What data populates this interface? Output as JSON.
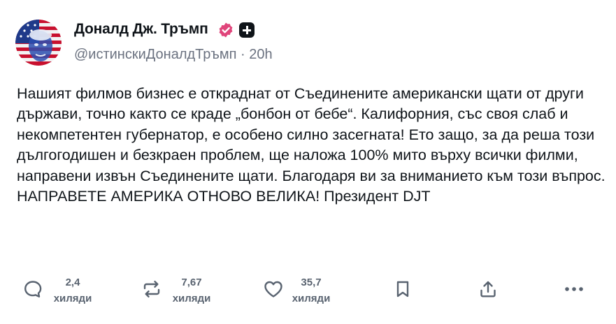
{
  "author": {
    "name": "Доналд Дж. Тръмп",
    "handle": "@истинскиДоналдТръмп",
    "separator": "·",
    "time": "20h",
    "verified_color": "#e0457b"
  },
  "post": {
    "text": "Нашият филмов бизнес е откраднат от Съединените американски щати от други държави, точно както се краде „бонбон от бебе“. Калифорния, със своя слаб и некомпетентен губернатор, е особено силно засегната! Ето защо, за да реша този дългогодишен и безкраен проблем, ще наложа 100% мито върху всички филми, направени извън Съединените щати. Благодаря ви за вниманието към този въпрос. НАПРАВЕТЕ АМЕРИКА ОТНОВО ВЕЛИКА! Президент DJT"
  },
  "actions": {
    "reply": {
      "icon": "comment-icon",
      "count": "2,4",
      "unit": "хиляди"
    },
    "repost": {
      "icon": "repost-icon",
      "count": "7,67",
      "unit": "хиляди"
    },
    "like": {
      "icon": "heart-icon",
      "count": "35,7",
      "unit": "хиляди"
    },
    "bookmark": {
      "icon": "bookmark-icon"
    },
    "share": {
      "icon": "share-icon"
    },
    "more": {
      "icon": "more-dots-icon"
    }
  }
}
